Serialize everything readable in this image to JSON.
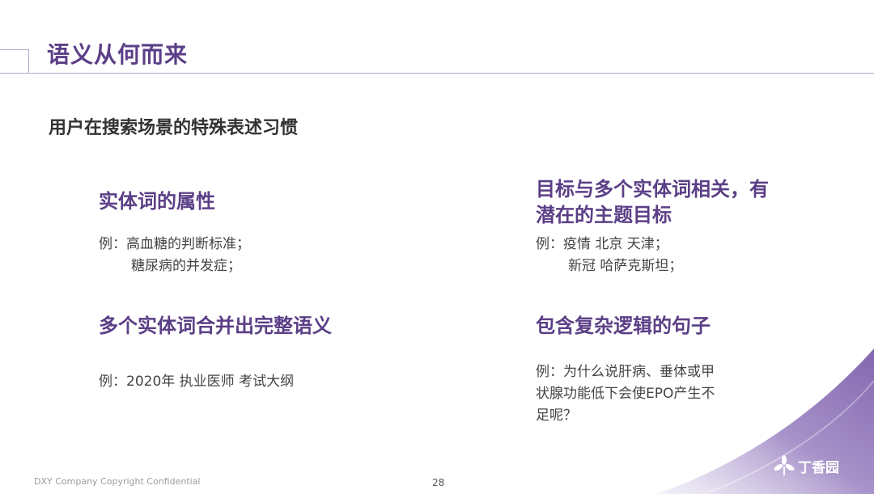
{
  "header": {
    "title": "语义从何而来"
  },
  "subtitle": "用户在搜索场景的特殊表述习惯",
  "sections": [
    {
      "title": "实体词的属性",
      "example_prefix": "例：",
      "lines": [
        "高血糖的判断标准；",
        "糖尿病的并发症；"
      ]
    },
    {
      "title_lines": [
        "目标与多个实体词相关，有",
        "潜在的主题目标"
      ],
      "example_prefix": "例：",
      "lines": [
        "疫情 北京 天津；",
        "新冠 哈萨克斯坦；"
      ]
    },
    {
      "title": "多个实体词合并出完整语义",
      "example_prefix": "例：",
      "lines": [
        "2020年 执业医师 考试大纲"
      ]
    },
    {
      "title": "包含复杂逻辑的句子",
      "example_lines": [
        "例：为什么说肝病、垂体或甲",
        "状腺功能低下会使EPO产生不",
        "足呢？"
      ]
    }
  ],
  "footer": {
    "copyright": "DXY Company Copyright Confidential",
    "page_number": "28"
  },
  "logo": {
    "text": "丁香园",
    "icon": "clove-flower-icon"
  },
  "colors": {
    "accent": "#5b3f86",
    "line": "#b6a6cf",
    "swoosh": "#8f77b5"
  }
}
